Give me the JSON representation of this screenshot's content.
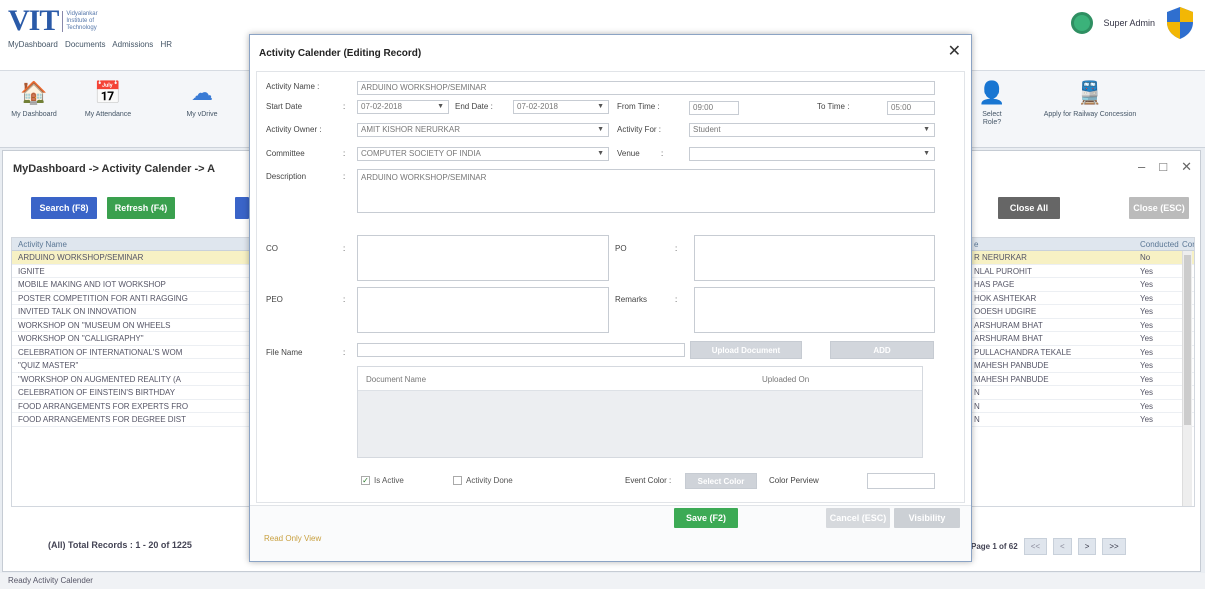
{
  "header": {
    "logo_text": "VIT",
    "logo_sub": "Vidyalankar Institute of Technology",
    "menus": [
      "MyDashboard",
      "Documents",
      "Admissions",
      "HR"
    ],
    "user": "Super Admin"
  },
  "ribbon": [
    {
      "label": "My Dashboard",
      "icon": "home-icon"
    },
    {
      "label": "My Attendance",
      "icon": "calendar-icon"
    },
    {
      "label": "My vDrive",
      "icon": "cloud-icon"
    },
    {
      "label": "Select Role?",
      "icon": "role-icon"
    },
    {
      "label": "Apply for Railway Concession",
      "icon": "train-icon"
    }
  ],
  "panel": {
    "breadcrumb": "MyDashboard -> Activity Calender -> A",
    "search_btn": "Search (F8)",
    "refresh_btn": "Refresh (F4)",
    "close_all_btn": "Close All",
    "close_btn": "Close (ESC)",
    "columns": {
      "activity": "Activity Name",
      "owner": "e",
      "conducted": "Conducted",
      "extra": "Cor"
    },
    "rows": [
      {
        "name": "ARDUINO WORKSHOP/SEMINAR",
        "owner": "R NERURKAR",
        "conducted": "No"
      },
      {
        "name": "IGNITE",
        "owner": "NLAL PUROHIT",
        "conducted": "Yes"
      },
      {
        "name": "MOBILE MAKING AND IOT WORKSHOP",
        "owner": "HAS PAGE",
        "conducted": "Yes"
      },
      {
        "name": "POSTER COMPETITION FOR ANTI RAGGING",
        "owner": "HOK ASHTEKAR",
        "conducted": "Yes"
      },
      {
        "name": "INVITED TALK ON INNOVATION",
        "owner": "OOESH UDGIRE",
        "conducted": "Yes"
      },
      {
        "name": "WORKSHOP ON \"MUSEUM ON WHEELS",
        "owner": "ARSHURAM BHAT",
        "conducted": "Yes"
      },
      {
        "name": "WORKSHOP ON \"CALLIGRAPHY\"",
        "owner": "ARSHURAM BHAT",
        "conducted": "Yes"
      },
      {
        "name": "CELEBRATION OF INTERNATIONAL'S WOM",
        "owner": "PULLACHANDRA TEKALE",
        "conducted": "Yes"
      },
      {
        "name": "\"QUIZ MASTER\"",
        "owner": "MAHESH PANBUDE",
        "conducted": "Yes"
      },
      {
        "name": "\"WORKSHOP ON AUGMENTED REALITY (A",
        "owner": "MAHESH PANBUDE",
        "conducted": "Yes"
      },
      {
        "name": "CELEBRATION OF EINSTEIN'S BIRTHDAY",
        "owner": "N",
        "conducted": "Yes"
      },
      {
        "name": "FOOD ARRANGEMENTS FOR EXPERTS FRO",
        "owner": "N",
        "conducted": "Yes"
      },
      {
        "name": "FOOD ARRANGEMENTS FOR DEGREE DIST",
        "owner": "N",
        "conducted": "Yes"
      }
    ],
    "total_records": "(All) Total Records : 1 - 20 of 1225",
    "page_info": "Page 1 of 62",
    "pager": [
      "<<",
      "<",
      ">",
      ">>"
    ]
  },
  "modal": {
    "title": "Activity Calender (Editing Record)",
    "labels": {
      "activity_name": "Activity Name :",
      "start_date": "Start Date",
      "end_date": "End Date :",
      "from_time": "From Time :",
      "to_time": "To Time :",
      "owner": "Activity Owner :",
      "activity_for": "Activity For :",
      "committee": "Committee",
      "venue": "Venue",
      "description": "Description",
      "co": "CO",
      "po": "PO",
      "peo": "PEO",
      "remarks": "Remarks",
      "file_name": "File Name"
    },
    "values": {
      "activity_name": "ARDUINO WORKSHOP/SEMINAR",
      "start_date": "07-02-2018",
      "end_date": "07-02-2018",
      "from_time": "09:00",
      "to_time": "05:00",
      "owner": "AMIT KISHOR NERURKAR",
      "activity_for": "Student",
      "committee": "COMPUTER SOCIETY OF INDIA",
      "venue": "",
      "description": "ARDUINO WORKSHOP/SEMINAR"
    },
    "upload_btn": "Upload Document",
    "add_btn": "ADD",
    "doc_cols": {
      "name": "Document Name",
      "uploaded": "Uploaded On"
    },
    "is_active": "Is Active",
    "activity_done": "Activity Done",
    "event_color": "Event Color :",
    "select_color": "Select Color",
    "color_preview": "Color Perview",
    "save_btn": "Save (F2)",
    "cancel_btn": "Cancel (ESC)",
    "visibility_btn": "Visibility",
    "read_only": "Read Only View"
  },
  "status": "Ready  Activity Calender",
  "colors": {
    "search": "#3a64c8",
    "refresh": "#3aa04e",
    "save": "#3caa55",
    "accent": "#2a5aa8"
  }
}
